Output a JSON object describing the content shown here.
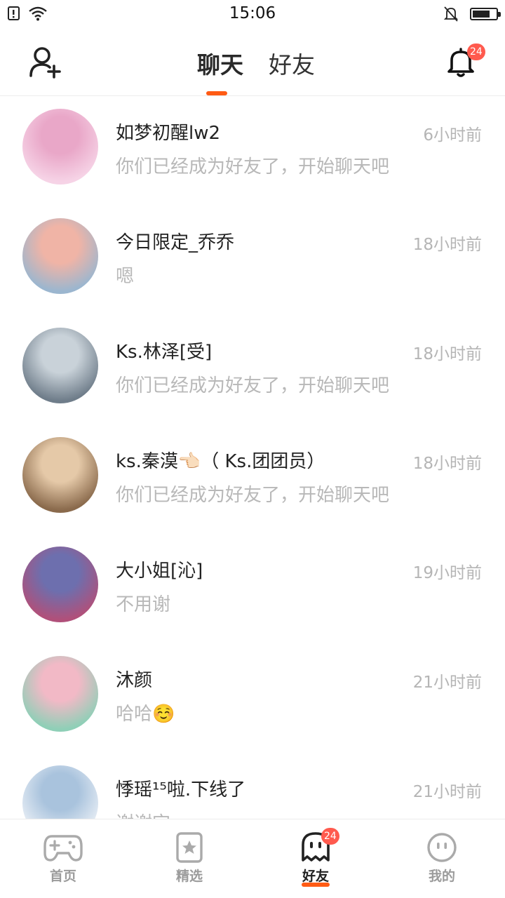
{
  "status_bar": {
    "time": "15:06",
    "battery_level": 0.75
  },
  "header": {
    "tabs": [
      {
        "label": "聊天",
        "active": true
      },
      {
        "label": "好友",
        "active": false
      }
    ],
    "notification_count": "24",
    "icons": [
      "add-user-icon",
      "bell-icon"
    ],
    "accent_color": "#ff5b14"
  },
  "chats": [
    {
      "name": "如梦初醒lw2",
      "time": "6小时前",
      "preview": "你们已经成为好友了，开始聊天吧",
      "avatar_colors": [
        "#f6d3e6",
        "#e9a7c8"
      ]
    },
    {
      "name": "今日限定_乔乔",
      "time": "18小时前",
      "preview": "嗯",
      "avatar_colors": [
        "#9bb6cf",
        "#f0b4a6"
      ]
    },
    {
      "name": "Ks.林泽[受]",
      "time": "18小时前",
      "preview": "你们已经成为好友了，开始聊天吧",
      "avatar_colors": [
        "#6f7d8a",
        "#c9d2d9"
      ]
    },
    {
      "name": "ks.秦漠👈🏻（ Ks.团团员）",
      "time": "18小时前",
      "preview": "你们已经成为好友了，开始聊天吧",
      "avatar_colors": [
        "#8a6a4c",
        "#e5c9a8"
      ]
    },
    {
      "name": "大小姐[沁]",
      "time": "19小时前",
      "preview": "不用谢",
      "avatar_colors": [
        "#b0507a",
        "#6d6fae"
      ]
    },
    {
      "name": "沐颜",
      "time": "21小时前",
      "preview": "哈哈☺️",
      "avatar_colors": [
        "#8fcfb7",
        "#f2b9c6"
      ]
    },
    {
      "name": "悸瑶¹⁵啦.下线了",
      "time": "21小时前",
      "preview": "谢谢宝",
      "avatar_colors": [
        "#e8eef5",
        "#a9c3dd"
      ]
    }
  ],
  "bottom_nav": [
    {
      "label": "首页",
      "icon": "gamepad-icon",
      "active": false,
      "badge": ""
    },
    {
      "label": "精选",
      "icon": "star-icon",
      "active": false,
      "badge": ""
    },
    {
      "label": "好友",
      "icon": "ghost-icon",
      "active": true,
      "badge": "24"
    },
    {
      "label": "我的",
      "icon": "face-icon",
      "active": false,
      "badge": ""
    }
  ]
}
